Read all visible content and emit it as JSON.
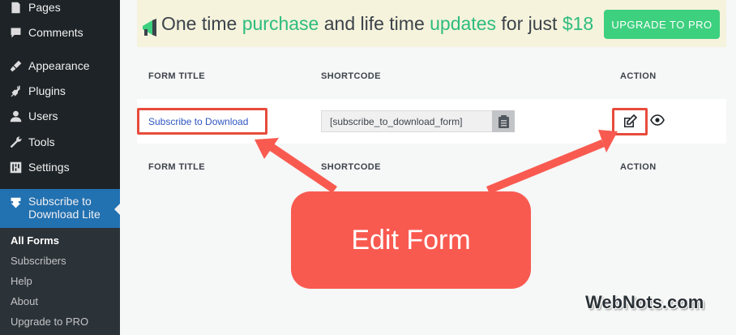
{
  "sidebar": {
    "items": [
      {
        "label": "Pages",
        "icon": "pages-icon"
      },
      {
        "label": "Comments",
        "icon": "comments-icon"
      },
      {
        "label": "Appearance",
        "icon": "appearance-icon"
      },
      {
        "label": "Plugins",
        "icon": "plugins-icon"
      },
      {
        "label": "Users",
        "icon": "users-icon"
      },
      {
        "label": "Tools",
        "icon": "tools-icon"
      },
      {
        "label": "Settings",
        "icon": "settings-icon"
      }
    ],
    "active_item": {
      "label_line1": "Subscribe to",
      "label_line2": "Download Lite",
      "icon": "download-icon"
    },
    "submenu": [
      "All Forms",
      "Subscribers",
      "Help",
      "About",
      "Upgrade to PRO"
    ]
  },
  "banner": {
    "part1": "One time ",
    "purchase": "purchase",
    "part2": " and life time ",
    "updates": "updates",
    "part3": " for just ",
    "price": "$18",
    "button": "UPGRADE TO PRO"
  },
  "table": {
    "headers": {
      "title": "FORM TITLE",
      "shortcode": "SHORTCODE",
      "action": "ACTION"
    },
    "rows": [
      {
        "title": "Subscribe to Download",
        "shortcode": "[subscribe_to_download_form]"
      }
    ]
  },
  "callout": {
    "text": "Edit Form"
  },
  "watermark": {
    "text": "WebNots.com"
  },
  "colors": {
    "sidebar_bg": "#1d2327",
    "active_bg": "#2271b1",
    "highlight_green": "#2ebc7e",
    "upgrade_btn": "#3dd07f",
    "annotation_red": "#e74c3c",
    "link_blue": "#2f57c2"
  }
}
